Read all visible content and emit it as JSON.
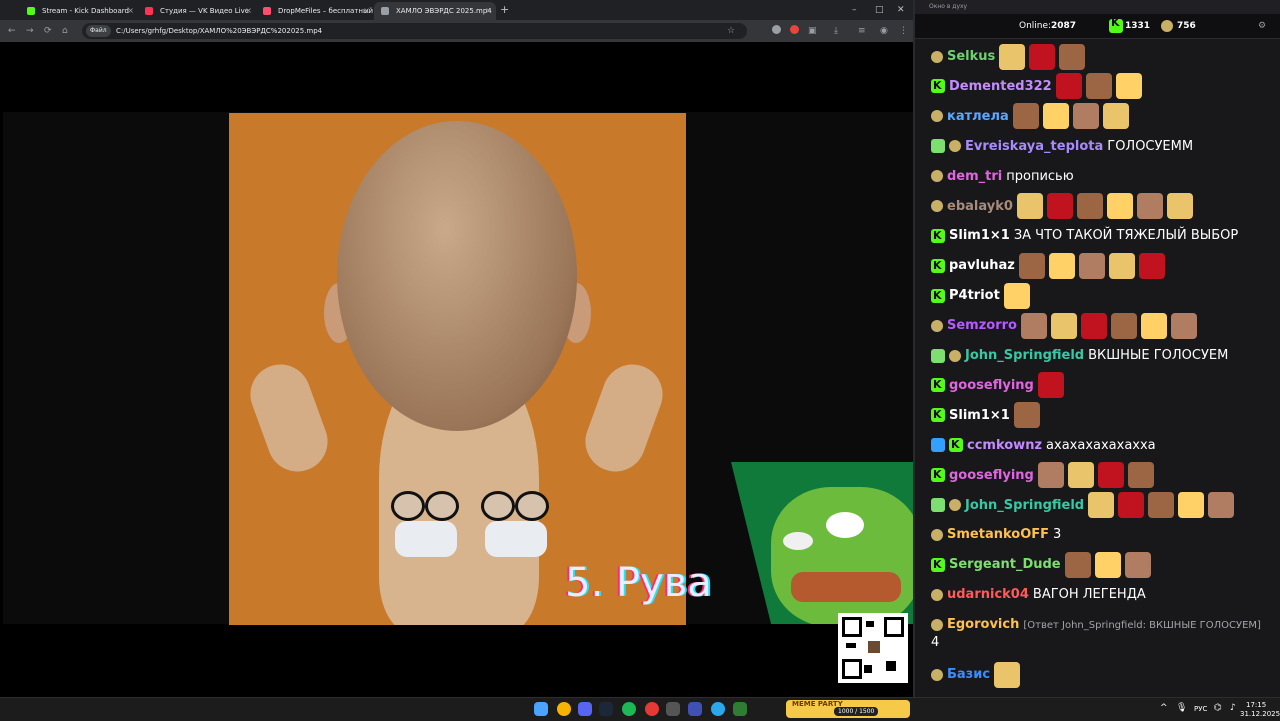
{
  "browser": {
    "tabs": [
      {
        "label": "Stream - Kick Dashboard",
        "color": "#53fc18"
      },
      {
        "label": "Студия — VK Видео Live",
        "color": "#ff3355"
      },
      {
        "label": "DropMeFiles – бесплатный фа...",
        "color": "#ff4d6d"
      },
      {
        "label": "ХАМЛО ЭВЭРДС 2025.mp4",
        "color": "#9aa0a6"
      }
    ],
    "new_tab": "+",
    "close": "×",
    "address_chip": "Файл",
    "url": "C:/Users/grhfg/Desktop/ХАМЛО%20ЭВЭРДС%202025.mp4"
  },
  "video": {
    "caption": "5. Рува"
  },
  "chat": {
    "window_title": "Окно в духу",
    "online_label": "Online:",
    "online_count": "2087",
    "kick_count": "1331",
    "twitch_count": "756",
    "messages": [
      {
        "user": "Selkus",
        "color": "#6fd06f",
        "text": "",
        "emotes": 3
      },
      {
        "user": "Demented322",
        "color": "#c28cff",
        "text": "",
        "emotes": 3
      },
      {
        "user": "катлела",
        "color": "#5aa7ff",
        "text": "",
        "emotes": 4
      },
      {
        "user": "Evreiskaya_teplota",
        "color": "#a78bfa",
        "text": "ГОЛОСУЕММ",
        "emotes": 0
      },
      {
        "user": "dem_tri",
        "color": "#e066e0",
        "text": "прописью",
        "emotes": 0
      },
      {
        "user": "ebalayk0",
        "color": "#a88b7a",
        "text": "",
        "emotes": 6
      },
      {
        "user": "Slim1×1",
        "color": "#ffffff",
        "text": "ЗА ЧТО ТАКОЙ ТЯЖЕЛЫЙ ВЫБОР",
        "emotes": 0
      },
      {
        "user": "pavluhaz",
        "color": "#ffffff",
        "text": "",
        "emotes": 5
      },
      {
        "user": "P4triot",
        "color": "#ffffff",
        "text": "",
        "emotes": 1
      },
      {
        "user": "Semzorro",
        "color": "#b45aff",
        "text": "",
        "emotes": 6
      },
      {
        "user": "John_Springfield",
        "color": "#35c9a5",
        "text": "ВКШНЫЕ ГОЛОСУЕМ",
        "emotes": 0
      },
      {
        "user": "gooseflying",
        "color": "#e066e0",
        "text": "",
        "emotes": 1
      },
      {
        "user": "Slim1×1",
        "color": "#ffffff",
        "text": "",
        "emotes": 1
      },
      {
        "user": "ccmkownz",
        "color": "#c28cff",
        "text": "ахахахахахахха",
        "emotes": 0
      },
      {
        "user": "gooseflying",
        "color": "#e066e0",
        "text": "",
        "emotes": 4
      },
      {
        "user": "John_Springfield",
        "color": "#35c9a5",
        "text": "",
        "emotes": 5
      },
      {
        "user": "SmetankoOFF",
        "color": "#ffc04d",
        "text": "3",
        "emotes": 0
      },
      {
        "user": "Sergeant_Dude",
        "color": "#7ddf6f",
        "text": "",
        "emotes": 3
      },
      {
        "user": "udarnick04",
        "color": "#ff5a5a",
        "text": "ВАГОН ЛЕГЕНДА",
        "emotes": 0
      },
      {
        "user": "Egorovich",
        "color": "#ffc04d",
        "reply": "[Ответ John_Springfield: ВКШНЫЕ ГОЛОСУЕМ]",
        "text": "4",
        "emotes": 0
      },
      {
        "user": "Базис",
        "color": "#3a8cff",
        "text": "",
        "emotes": 1
      }
    ]
  },
  "taskbar": {
    "lang": "РУС",
    "time": "17:15",
    "date": "31.12.2025",
    "widget": "MEME PARTY",
    "widget_count": "1000 / 1500"
  }
}
